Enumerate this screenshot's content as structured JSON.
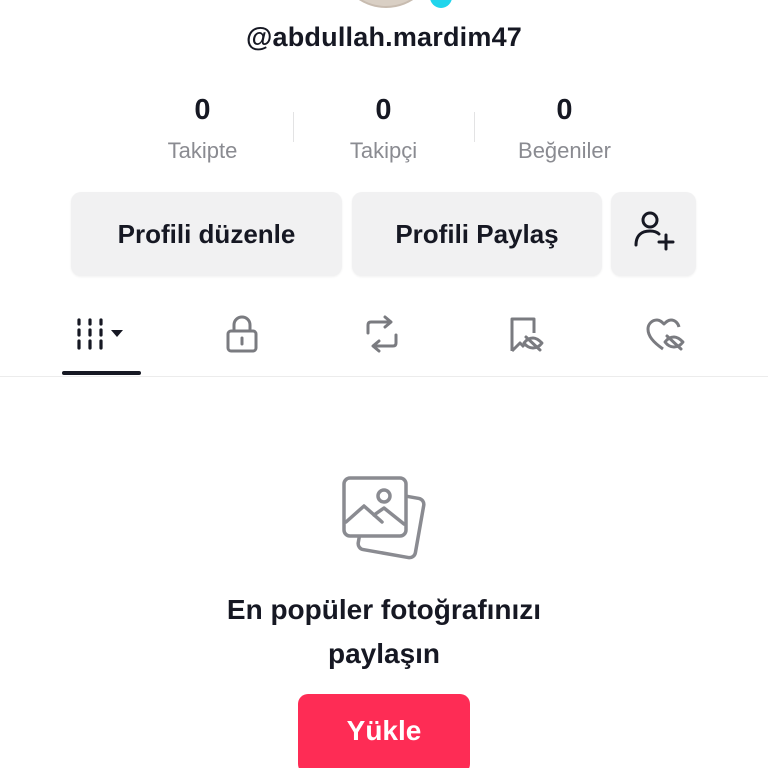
{
  "profile": {
    "username": "@abdullah.mardim47"
  },
  "stats": [
    {
      "value": "0",
      "label": "Takipte"
    },
    {
      "value": "0",
      "label": "Takipçi"
    },
    {
      "value": "0",
      "label": "Beğeniler"
    }
  ],
  "actions": {
    "edit_profile_label": "Profili düzenle",
    "share_profile_label": "Profili Paylaş",
    "add_friend_icon": "person-plus-icon"
  },
  "tabs": [
    {
      "icon": "grid-dropdown-icon",
      "active": true
    },
    {
      "icon": "lock-icon",
      "active": false
    },
    {
      "icon": "repost-icon",
      "active": false
    },
    {
      "icon": "bookmark-hidden-icon",
      "active": false
    },
    {
      "icon": "heart-hidden-icon",
      "active": false
    }
  ],
  "empty_state": {
    "icon": "photos-icon",
    "line1": "En popüler fotoğrafınızı",
    "line2": "paylaşın",
    "button_label": "Yükle"
  },
  "colors": {
    "accent": "#fe2c55",
    "avatar_badge": "#20d5ec",
    "text_primary": "#161823",
    "text_secondary": "#8a8b91",
    "button_bg": "#f1f1f2"
  }
}
